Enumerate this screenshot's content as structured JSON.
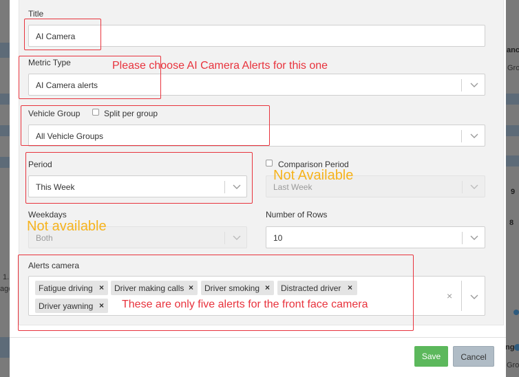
{
  "background": {
    "fragments": [
      "anc",
      "Grou",
      "9",
      "8",
      "1.",
      "age",
      "ng",
      "Grou"
    ]
  },
  "form": {
    "title_label": "Title",
    "title_value": "AI Camera",
    "metric_type_label": "Metric Type",
    "metric_type_value": "AI Camera alerts",
    "vehicle_group_label": "Vehicle Group",
    "split_per_group_label": "Split per group",
    "vehicle_group_value": "All Vehicle Groups",
    "period_label": "Period",
    "period_value": "This Week",
    "comparison_period_label": "Comparison Period",
    "comparison_period_value": "Last Week",
    "weekdays_label": "Weekdays",
    "weekdays_value": "Both",
    "number_of_rows_label": "Number of Rows",
    "number_of_rows_value": "10",
    "alerts_camera_label": "Alerts camera",
    "alerts_tags": [
      "Fatigue driving",
      "Driver making calls",
      "Driver smoking",
      "Distracted driver",
      "Driver yawning"
    ],
    "tag_remove_glyph": "×",
    "clear_glyph": "×"
  },
  "footer": {
    "save_label": "Save",
    "cancel_label": "Cancel"
  },
  "annotations": {
    "metric_note": "Please choose AI Camera Alerts for this one",
    "comparison_note": "Not Available",
    "weekdays_note": "Not available",
    "alerts_note": "These are only five alerts for the front face camera"
  },
  "colors": {
    "annotation_red": "#e8323c",
    "annotation_amber": "#f6b31d",
    "save_green": "#5cb85c",
    "cancel_gray": "#b0bcc6"
  }
}
